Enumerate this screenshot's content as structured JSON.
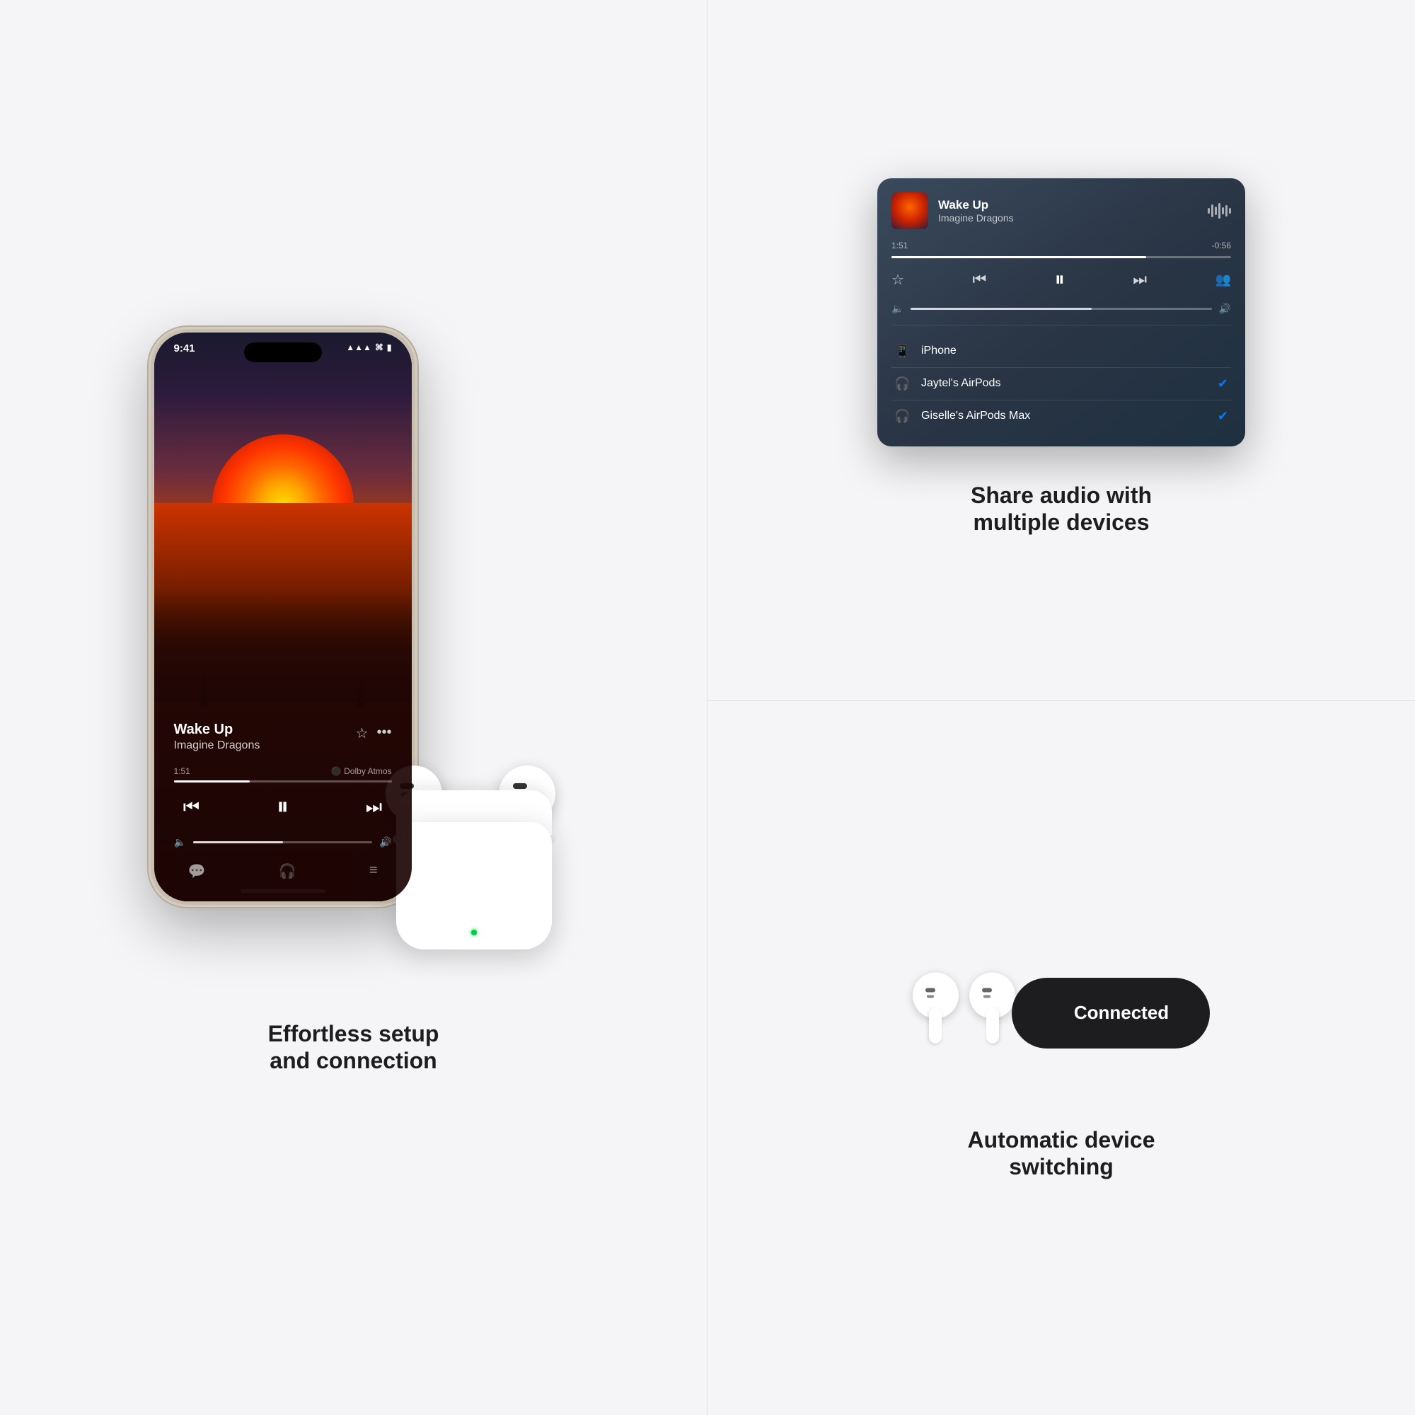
{
  "background_color": "#f5f5f7",
  "left_panel": {
    "phone": {
      "time": "9:41",
      "signal_icon": "▲▲▲",
      "wifi_icon": "WiFi",
      "battery_icon": "▮▮▮",
      "song_title": "Wake Up",
      "artist": "Imagine Dragons",
      "time_elapsed": "1:51",
      "dolby_text": "Dolby Atmos"
    },
    "caption_line1": "Effortless setup",
    "caption_line2": "and connection"
  },
  "right_panel": {
    "top": {
      "card": {
        "song_title": "Wake Up",
        "artist": "Imagine Dragons",
        "time_elapsed": "1:51",
        "time_remaining": "-0:56",
        "devices": [
          {
            "name": "iPhone",
            "icon": "phone",
            "selected": false
          },
          {
            "name": "Jaytel's AirPods",
            "icon": "airpods",
            "selected": true
          },
          {
            "name": "Giselle's AirPods Max",
            "icon": "headphones",
            "selected": true
          }
        ]
      },
      "caption_line1": "Share audio with",
      "caption_line2": "multiple devices"
    },
    "bottom": {
      "connected_label": "Connected",
      "caption_line1": "Automatic device",
      "caption_line2": "switching"
    }
  }
}
